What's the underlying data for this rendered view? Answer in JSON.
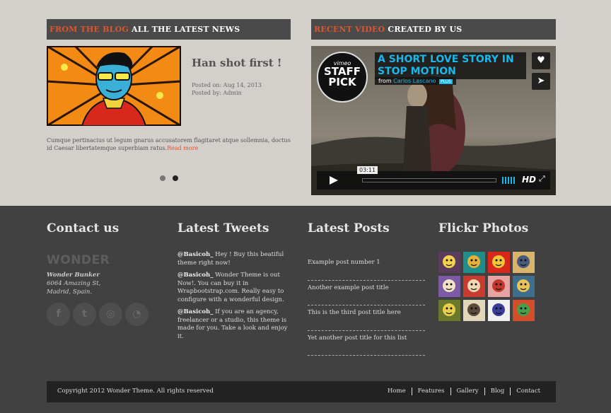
{
  "blog": {
    "heading_accent": "FROM THE BLOG",
    "heading_rest": "ALL THE LATEST NEWS",
    "post_title": "Han shot first !",
    "posted_on": "Posted on: Aug 14, 2013",
    "posted_by": "Posted by: Admin",
    "excerpt": "Cumque pertinacius ut legum gnarus accusatorem flagitaret atque sollemnia, doctus id Caesar libertatemque superbiam ratus.",
    "read_more": "Read more",
    "slider_active_index": 2
  },
  "video": {
    "heading_accent": "RECENT VIDEO",
    "heading_rest": "CREATED BY US",
    "badge_brand": "vimeo",
    "badge_line1": "STAFF",
    "badge_line2": "PICK",
    "title": "A SHORT LOVE STORY IN STOP MOTION",
    "from_label": "from",
    "author": "Carlos Lascano",
    "plus_badge": "PLUS",
    "timecode": "03:11",
    "hd_label": "HD",
    "like_icon": "heart-icon",
    "share_icon": "send-icon",
    "accent_color": "#1ab7ea"
  },
  "footer": {
    "contact_title": "Contact us",
    "logo_text": "WONDER",
    "company_name": "Wonder Bunker",
    "address_line1": "6064 Amazing St,",
    "address_line2": "Madrid, Spain.",
    "socials": [
      {
        "icon": "facebook-icon",
        "glyph": "f"
      },
      {
        "icon": "twitter-icon",
        "glyph": "t"
      },
      {
        "icon": "dribbble-icon",
        "glyph": "◎"
      },
      {
        "icon": "rss-icon",
        "glyph": "◔"
      }
    ],
    "tweets_title": "Latest Tweets",
    "tweets": [
      {
        "handle": "@Basicoh_",
        "text": " Hey ! Buy this beatiful theme right now!"
      },
      {
        "handle": "@Basicoh_",
        "text": " Wonder Theme is out Now!. You can buy it in Wrapbootstrap.com. Really easy to configure with a wonderful design."
      },
      {
        "handle": "@Basicoh_",
        "text": " If you are an agency, freelancer or a studio, this theme is made for you. Take a look and enjoy it."
      }
    ],
    "posts_title": "Latest Posts",
    "posts": [
      "Example post number 1",
      "Another example post title",
      "This is the third post title here",
      "Yet another post title for this list"
    ],
    "flickr_title": "Flickr Photos",
    "copyright": "Copyright 2012 Wonder Theme. All rights reserved",
    "nav": [
      "Home",
      "Features",
      "Gallery",
      "Blog",
      "Contact"
    ]
  },
  "colors": {
    "accent": "#e0532f",
    "page_bg": "#d3d0cb",
    "footer_bg": "#414141",
    "bar_bg": "#222222"
  }
}
